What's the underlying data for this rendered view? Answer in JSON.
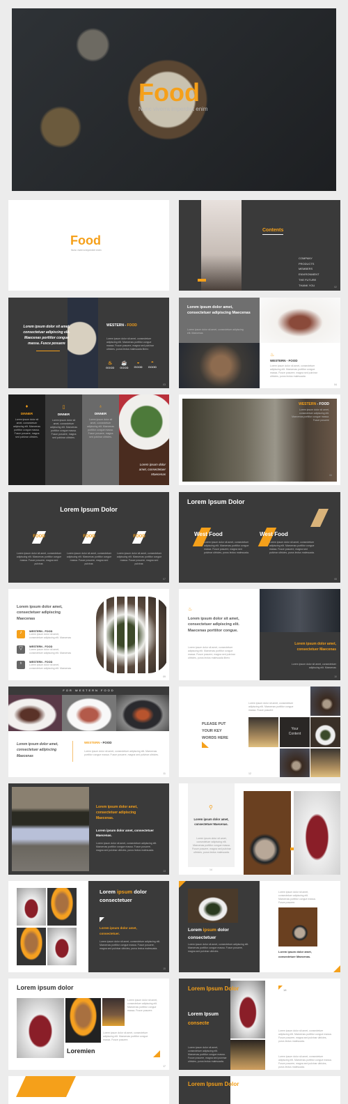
{
  "colors": {
    "accent": "#f5a01a",
    "dark": "#3a3a3a",
    "background": "#ececec"
  },
  "hero": {
    "title": "Food",
    "subtitle": "Nunc viverra imperdiet enim"
  },
  "s1": {
    "title": "Food",
    "subtitle": "Nunc viverra imperdiet enim"
  },
  "s2": {
    "title": "Contents",
    "items": [
      "COMPANY",
      "PRODUCTS",
      "MEMBERS",
      "ENVIRONMENT",
      "THE FUTURE",
      "THANK YOU"
    ],
    "num": "02"
  },
  "s3": {
    "quote": "Lorem ipsum dolor sit amet, consectetuer adipiscing elit. Maecenas porttitor congue massa. Fusce posuere",
    "h1": "WESTERN - ",
    "h2": "FOOD",
    "body": "Lorem ipsum dolor sit amet, consectetuer adipiscing elit. Maecenas porttitor congue massa. Fusce posuere, magna sed pulvinar ultricies, purus lectus malesuada libero",
    "icons": [
      "GOOD",
      "GOOD",
      "GOOD",
      "GOOD"
    ],
    "num": "03"
  },
  "s4": {
    "title": "Lorem ipsum dolor amet, consectetuer adipiscing Maecenas",
    "sub": "Lorem ipsum dolor sit amet, consectetuer adipiscing elit. Maecenas",
    "h": "WESTERN - FOOD",
    "body": "Lorem ipsum dolor sit amet, consectetuer adipiscing elit. Maecenas porttitor congue massa. Fusce posuere, magna sed pulvinar ultricies, purus lectus malesuada",
    "num": "04"
  },
  "s5": {
    "cols": [
      "DINNER",
      "DINNER",
      "DINNER"
    ],
    "body": "Lorem ipsum dolor sit amet, consectetuer adipiscing elit. Maecenas porttitor congue massa. Fusce posuere, magna sed pulvinar ultricies.",
    "caption": "Lorem ipsum dolor amet, consectetuer Maecenas"
  },
  "s6": {
    "h1": "WESTERN",
    "h2": " - FOOD",
    "body": "Lorem ipsum dolor sit amet, consectetuer adipiscing elit. Maecenas porttitor congue massa. Fusce posuere",
    "num": "06"
  },
  "s7": {
    "title": "Lorem Ipsum Dolor",
    "labels": [
      "FOOD",
      "FOOD",
      "FOOD"
    ],
    "body": "Lorem ipsum dolor sit amet, consectetuer adipiscing elit. Maecenas porttitor congue massa. Fusce posuere, magna sed pulvinar.",
    "num": "07"
  },
  "s8": {
    "title": "Lorem Ipsum Dolor",
    "labels": [
      "West Food",
      "West Food"
    ],
    "body": "Lorem ipsum dolor sit amet, consectetuer adipiscing elit. Maecenas porttitor congue massa. Fusce posuere, magna sed pulvinar ultricies, purus lectus malesuada.",
    "num": "08"
  },
  "s9": {
    "title": "Lorem ipsum dolor amet, consectetuer adipiscing Maecenas",
    "items": [
      "WESTERN - FOOD",
      "WESTERN - FOOD",
      "WESTERN - FOOD"
    ],
    "body": "Lorem ipsum dolor sit amet, consectetuer adipiscing elit. Maecenas",
    "num": "09"
  },
  "s10": {
    "title": "Lorem ipsum dolor sit amet, consectetuer adipiscing elit. Maecenas porttitor congue.",
    "body": "Lorem ipsum dolor sit amet, consectetuer adipiscing elit. Maecenas porttitor congue massa. Fusce posuere, magna sed pulvinar ultricies, purus lectus malesuada libero",
    "callout": "Lorem ipsum dolor amet, consectetuer Maecenas",
    "sub": "Lorem ipsum dolor sit amet, consectetuer adipiscing elit. Maecenas",
    "num": "10"
  },
  "s11": {
    "banner": "FOR WESTERN FOOD",
    "quote": "Lorem ipsum dolor amet, consectetuer adipiscing Maecenas",
    "h1": "WESTERN",
    "h2": " - FOOD",
    "body": "Lorem ipsum dolor sit amet, consectetuer adipiscing elit. Maecenas porttitor congue massa. Fusce posuere, magna sed pulvinar ultricies.",
    "num": "11"
  },
  "s12": {
    "title": "PLEASE PUT YOUR KEY WORDS HERE",
    "body": "Lorem ipsum dolor sit amet, consectetuer adipiscing elit. Maecenas porttitor congue massa. Fusce posuere",
    "tile": "Your Content",
    "num": "12"
  },
  "s13": {
    "title": "Lorem ipsum dolor amet, consectetuer adipiscing Maecenas.",
    "sub": "Lorem ipsum dolor amet, consectetuer Maecenas.",
    "body": "Lorem ipsum dolor sit amet, consectetuer adipiscing elit. Maecenas porttitor congue massa. Fusce posuere, magna sed pulvinar ultricies, purus lectus malesuada.",
    "num": "13"
  },
  "s14": {
    "title": "Lorem ipsum dolor amet, consectetuer Maecenas.",
    "body": "Lorem ipsum dolor sit amet, consectetuer adipiscing elit. Maecenas porttitor congue massa. Fusce posuere, magna sed pulvinar ultricies, purus lectus malesuada.",
    "num": "14"
  },
  "s15": {
    "t1": "Lorem ",
    "t2": "ipsum",
    "t3": " dolor consectetuer",
    "sub": "Lorem ipsum dolor amet, consectetuer.",
    "body": "Lorem ipsum dolor sit amet, consectetuer adipiscing elit. Maecenas porttitor congue massa. Fusce posuere, magna sed pulvinar ultricies, purus lectus malesuada.",
    "num": "15"
  },
  "s16": {
    "t1": "Lorem ",
    "t2": "ipsum",
    "t3": " dolor consectetuer",
    "body": "Lorem ipsum dolor sit amet, consectetuer adipiscing elit. Maecenas porttitor congue massa. Fusce posuere, magna sed pulvinar ultricies.",
    "side": "Lorem ipsum dolor sit amet, consectetuer adipiscing elit. Maecenas porttitor congue massa. Fusce posuere.",
    "caption": "Lorem ipsum dolor amet, consectetuer Maecenas."
  },
  "s17": {
    "title": "Lorem ipsum dolor",
    "body": "Lorem ipsum dolor sit amet, consectetuer adipiscing elit. Maecenas porttitor congue massa. Fusce posuere.",
    "brand": "Loremien",
    "num": "17"
  },
  "s18": {
    "title": "Lorem Ipsum Dolor",
    "sub1": "Lorem Ipsum",
    "sub2": "consecte",
    "body": "Lorem ipsum dolor sit amet, consectetuer adipiscing elit. Maecenas porttitor congue massa. Fusce posuere, magna sed pulvinar ultricies, purus lectus malesuada.",
    "num": "18"
  },
  "s20": {
    "title": "Lorem Ipsum Dolor"
  }
}
